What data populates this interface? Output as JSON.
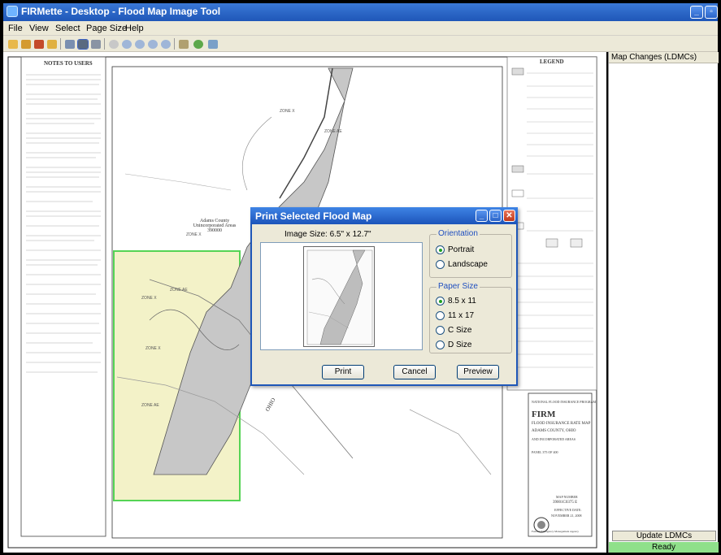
{
  "window": {
    "title": "FIRMette - Desktop - Flood Map Image Tool"
  },
  "menu": [
    "File",
    "View",
    "Select",
    "Page Size",
    "Help"
  ],
  "toolbar": {
    "icons": [
      "open-icon",
      "save-icon",
      "export-icon",
      "copy-icon",
      "refresh-icon",
      "print-icon",
      "print-preview-icon",
      "pan-icon",
      "zoom-in-icon",
      "zoom-out-icon",
      "zoom-extent-icon",
      "zoom-previous-icon",
      "layers-icon",
      "settings-icon",
      "close-map-icon"
    ]
  },
  "map": {
    "notes_title": "NOTES TO USERS",
    "legend_title": "LEGEND",
    "area_label": "Adams County Unincorporated Areas 390000",
    "zone_labels": [
      "ZONE X",
      "ZONE AE",
      "ZONE X",
      "ZONE AE",
      "ZONE X",
      "ZONE X",
      "ZONE AE"
    ],
    "river_label": "OHIO",
    "title_block": {
      "program": "NATIONAL FLOOD INSURANCE PROGRAM",
      "firm": "FIRM",
      "subtitle": "FLOOD INSURANCE RATE MAP",
      "county": "ADAMS COUNTY, OHIO",
      "areas": "AND INCORPORATED AREAS",
      "panel": "PANEL 375 OF 400",
      "map_number_label": "MAP NUMBER",
      "map_number": "39001C0375 E",
      "effective_label": "EFFECTIVE DATE:",
      "effective_date": "NOVEMBER 21, 2008",
      "agency": "Federal Emergency Management Agency"
    }
  },
  "panel": {
    "header": "Map Changes (LDMCs)",
    "update_button": "Update LDMCs",
    "status": "Ready"
  },
  "dialog": {
    "title": "Print Selected Flood Map",
    "image_size": "Image Size: 6.5\" x 12.7\"",
    "orientation_label": "Orientation",
    "orientation_options": [
      "Portrait",
      "Landscape"
    ],
    "orientation_selected": "Portrait",
    "paper_label": "Paper Size",
    "paper_options": [
      "8.5 x 11",
      "11 x 17",
      "C Size",
      "D Size"
    ],
    "paper_selected": "8.5 x 11",
    "buttons": {
      "print": "Print",
      "cancel": "Cancel",
      "preview": "Preview"
    }
  },
  "colors": {
    "selection_fill": "#f3f2c8",
    "selection_border": "#55d455",
    "titlebar": "#2463c8",
    "status_ready": "#8fe08a"
  }
}
